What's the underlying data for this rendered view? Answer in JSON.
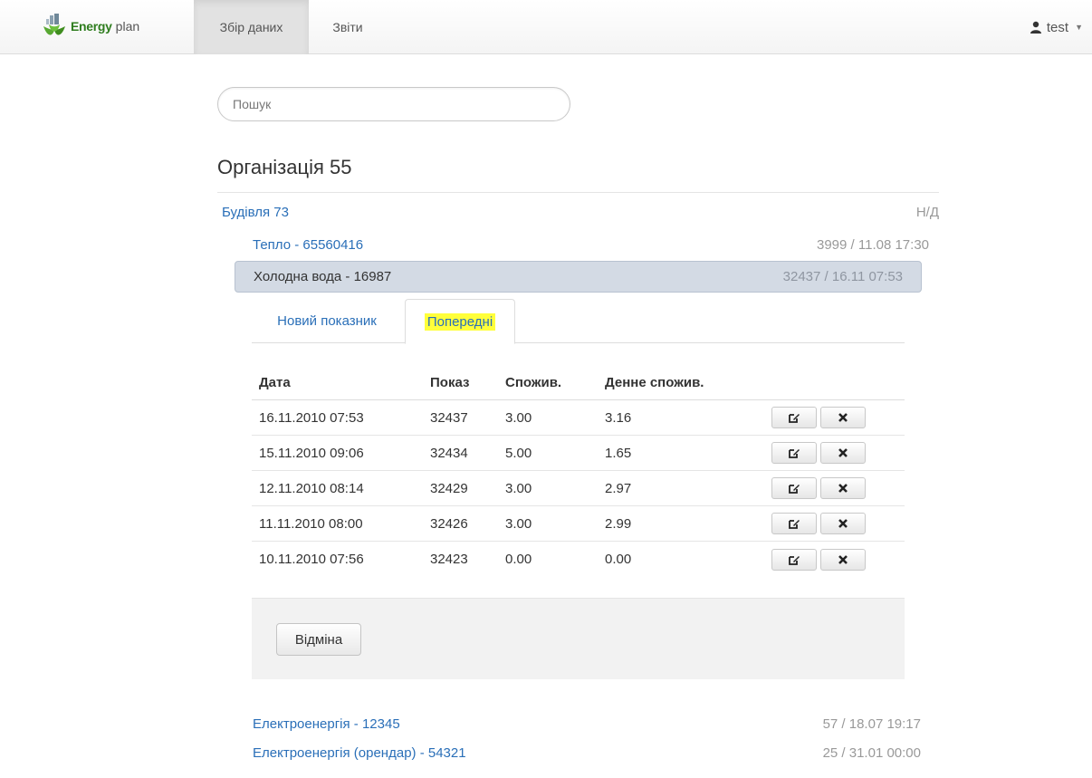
{
  "navbar": {
    "brand_part1": "Energy",
    "brand_part2": "plan",
    "tabs": [
      {
        "label": "Збір даних",
        "active": true
      },
      {
        "label": "Звіти",
        "active": false
      }
    ],
    "user": "test"
  },
  "search": {
    "placeholder": "Пошук"
  },
  "organization": {
    "title": "Організація 55"
  },
  "building": {
    "label": "Будівля 73",
    "status": "Н/Д"
  },
  "meters": {
    "heat": {
      "label": "Тепло - 65560416",
      "value": "3999 / 11.08 17:30"
    },
    "cold_water": {
      "label": "Холодна вода - 16987",
      "value": "32437 / 16.11 07:53"
    },
    "electricity": {
      "label": "Електроенергія - 12345",
      "value": "57 / 18.07 19:17"
    },
    "electricity_rent": {
      "label": "Електроенергія (орендар) - 54321",
      "value": "25 / 31.01 00:00"
    }
  },
  "tabs": {
    "new_reading": "Новий показник",
    "previous": "Попередні"
  },
  "table": {
    "headers": [
      "Дата",
      "Показ",
      "Спожив.",
      "Денне спожив."
    ],
    "rows": [
      [
        "16.11.2010 07:53",
        "32437",
        "3.00",
        "3.16"
      ],
      [
        "15.11.2010 09:06",
        "32434",
        "5.00",
        "1.65"
      ],
      [
        "12.11.2010 08:14",
        "32429",
        "3.00",
        "2.97"
      ],
      [
        "11.11.2010 08:00",
        "32426",
        "3.00",
        "2.99"
      ],
      [
        "10.11.2010 07:56",
        "32423",
        "0.00",
        "0.00"
      ]
    ]
  },
  "actions": {
    "cancel": "Відміна"
  },
  "colors": {
    "link": "#2a6fb8",
    "highlight": "#ffff3a",
    "selected_row": "#d3dae4"
  }
}
